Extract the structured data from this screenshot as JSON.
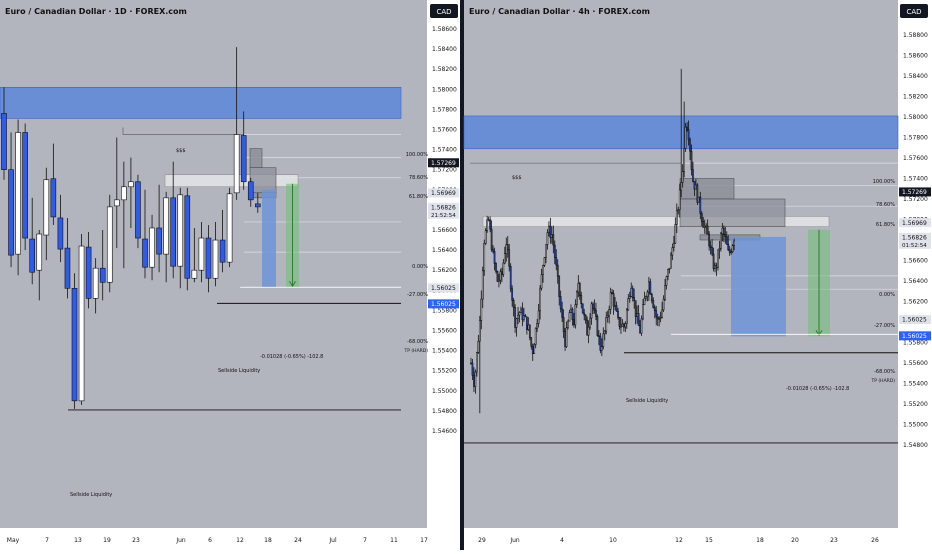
{
  "theme": {
    "bg": "#b2b5be",
    "axis_bg": "#ffffff",
    "bull": "#ffffff",
    "bear": "#2f5bea",
    "wick": "#111111",
    "zone": "#4c7ee0",
    "grey_box": "#8c8f99",
    "light_box": "#e4e5e8",
    "fib_line": "#dfe1e6",
    "measure_blue": "#6f94d8",
    "measure_green": "#6fbf72",
    "measure_arrow": "#2e7d32",
    "tag_black": "#131722",
    "tag_blue": "#2962ff",
    "tag_grey": "#e0e3eb",
    "text": "#111111"
  },
  "chart_data": [
    {
      "type": "candlestick",
      "title": "Euro / Canadian Dollar · 1D · FOREX.com",
      "currency_label": "CAD",
      "y_ticks": [
        "1.54600",
        "1.54800",
        "1.55000",
        "1.55200",
        "1.55400",
        "1.55600",
        "1.55800",
        "1.56000",
        "1.56200",
        "1.56400",
        "1.56600",
        "1.56800",
        "1.57000",
        "1.57200",
        "1.57400",
        "1.57600",
        "1.57800",
        "1.58000",
        "1.58200",
        "1.58400",
        "1.58600"
      ],
      "ylim": [
        1.5445,
        1.5878
      ],
      "x_ticks": [
        "May",
        "7",
        "13",
        "19",
        "23",
        "Jun",
        "6",
        "12",
        "18",
        "24",
        "Jul",
        "7",
        "11",
        "17"
      ],
      "price_tags": [
        {
          "value": "1.57269",
          "price": 1.57269,
          "style": "black"
        },
        {
          "value": "1.56969",
          "price": 1.56969,
          "style": "grey"
        },
        {
          "value": "1.56826",
          "price": 1.56826,
          "sub": "21:52:54",
          "style": "grey"
        },
        {
          "value": "1.56025",
          "price": 1.56025,
          "style": "grey"
        },
        {
          "value": "1.56025",
          "price": 1.55865,
          "style": "blue"
        }
      ],
      "candles": [
        {
          "o": 1.5776,
          "h": 1.5802,
          "l": 1.571,
          "c": 1.572
        },
        {
          "o": 1.572,
          "h": 1.5757,
          "l": 1.5623,
          "c": 1.5635
        },
        {
          "o": 1.5636,
          "h": 1.577,
          "l": 1.5615,
          "c": 1.5757
        },
        {
          "o": 1.5757,
          "h": 1.5766,
          "l": 1.564,
          "c": 1.5652
        },
        {
          "o": 1.5651,
          "h": 1.5692,
          "l": 1.5606,
          "c": 1.5618
        },
        {
          "o": 1.562,
          "h": 1.566,
          "l": 1.559,
          "c": 1.5656
        },
        {
          "o": 1.5655,
          "h": 1.5722,
          "l": 1.563,
          "c": 1.571
        },
        {
          "o": 1.5711,
          "h": 1.5746,
          "l": 1.5665,
          "c": 1.5673
        },
        {
          "o": 1.5672,
          "h": 1.5695,
          "l": 1.5628,
          "c": 1.5641
        },
        {
          "o": 1.5642,
          "h": 1.5672,
          "l": 1.5592,
          "c": 1.5602
        },
        {
          "o": 1.5602,
          "h": 1.5617,
          "l": 1.5482,
          "c": 1.549
        },
        {
          "o": 1.549,
          "h": 1.5656,
          "l": 1.5486,
          "c": 1.5644
        },
        {
          "o": 1.5643,
          "h": 1.5658,
          "l": 1.5582,
          "c": 1.5592
        },
        {
          "o": 1.5592,
          "h": 1.5632,
          "l": 1.5577,
          "c": 1.5622
        },
        {
          "o": 1.5622,
          "h": 1.566,
          "l": 1.559,
          "c": 1.5608
        },
        {
          "o": 1.5608,
          "h": 1.5695,
          "l": 1.5598,
          "c": 1.5683
        },
        {
          "o": 1.5684,
          "h": 1.5752,
          "l": 1.5642,
          "c": 1.569
        },
        {
          "o": 1.569,
          "h": 1.5728,
          "l": 1.5622,
          "c": 1.5703
        },
        {
          "o": 1.5703,
          "h": 1.5732,
          "l": 1.5662,
          "c": 1.5708
        },
        {
          "o": 1.5708,
          "h": 1.5715,
          "l": 1.5642,
          "c": 1.5652
        },
        {
          "o": 1.5651,
          "h": 1.57,
          "l": 1.5612,
          "c": 1.5623
        },
        {
          "o": 1.5623,
          "h": 1.5675,
          "l": 1.561,
          "c": 1.5662
        },
        {
          "o": 1.5662,
          "h": 1.5705,
          "l": 1.5618,
          "c": 1.5636
        },
        {
          "o": 1.5636,
          "h": 1.5698,
          "l": 1.5608,
          "c": 1.5692
        },
        {
          "o": 1.5692,
          "h": 1.5728,
          "l": 1.5612,
          "c": 1.5624
        },
        {
          "o": 1.5624,
          "h": 1.5702,
          "l": 1.5602,
          "c": 1.5695
        },
        {
          "o": 1.5694,
          "h": 1.5702,
          "l": 1.56,
          "c": 1.5612
        },
        {
          "o": 1.5612,
          "h": 1.5662,
          "l": 1.5608,
          "c": 1.562
        },
        {
          "o": 1.562,
          "h": 1.5668,
          "l": 1.5608,
          "c": 1.5652
        },
        {
          "o": 1.5652,
          "h": 1.5665,
          "l": 1.5598,
          "c": 1.5612
        },
        {
          "o": 1.5612,
          "h": 1.5668,
          "l": 1.5604,
          "c": 1.565
        },
        {
          "o": 1.565,
          "h": 1.568,
          "l": 1.5618,
          "c": 1.5628
        },
        {
          "o": 1.5628,
          "h": 1.5702,
          "l": 1.5623,
          "c": 1.5696
        },
        {
          "o": 1.5697,
          "h": 1.5842,
          "l": 1.569,
          "c": 1.5755
        },
        {
          "o": 1.5754,
          "h": 1.5778,
          "l": 1.57,
          "c": 1.5708
        },
        {
          "o": 1.5708,
          "h": 1.5712,
          "l": 1.5683,
          "c": 1.569
        },
        {
          "o": 1.5686,
          "h": 1.5697,
          "l": 1.5677,
          "c": 1.5683
        }
      ],
      "annotations": {
        "ssl_high_label": "$$$",
        "ssl_low_label": "Sellside Liquidity",
        "ssl_mid_label": "Sellside Liquidity",
        "fib_levels": [
          "100.00%",
          "78.60%",
          "61.80%",
          "0.00%",
          "-27.00%",
          "-68.00%"
        ],
        "tp_label": "TP (HARD)",
        "measure_label": "-0.01028 (-0.65%) -102.8"
      }
    },
    {
      "type": "candlestick",
      "title": "Euro / Canadian Dollar · 4h · FOREX.com",
      "currency_label": "CAD",
      "y_ticks": [
        "1.54800",
        "1.55000",
        "1.55200",
        "1.55400",
        "1.55600",
        "1.55800",
        "1.56000",
        "1.56200",
        "1.56400",
        "1.56600",
        "1.56800",
        "1.57000",
        "1.57200",
        "1.57400",
        "1.57600",
        "1.57800",
        "1.58000",
        "1.58200",
        "1.58400",
        "1.58600",
        "1.58800"
      ],
      "ylim": [
        1.5475,
        1.5897
      ],
      "x_ticks": [
        "29",
        "Jun",
        "4",
        "10",
        "12",
        "15",
        "18",
        "20",
        "23",
        "26"
      ],
      "price_tags": [
        {
          "value": "1.57269",
          "price": 1.57269,
          "style": "black"
        },
        {
          "value": "1.56969",
          "price": 1.56969,
          "style": "grey"
        },
        {
          "value": "1.56826",
          "price": 1.56826,
          "sub": "01:52:54",
          "style": "grey"
        },
        {
          "value": "1.56025",
          "price": 1.56025,
          "style": "grey"
        },
        {
          "value": "1.56025",
          "price": 1.55865,
          "style": "blue"
        }
      ],
      "candles": [],
      "annotations": {
        "ssl_high_label": "$$$",
        "ssl_low_label": "Sellside Liquidity",
        "fib_levels": [
          "100.00%",
          "78.60%",
          "61.80%",
          "0.00%",
          "-27.00%",
          "-68.00%"
        ],
        "tp_label": "TP (HARD)",
        "measure_label": "-0.01028 (-0.65%) -102.8"
      }
    }
  ]
}
